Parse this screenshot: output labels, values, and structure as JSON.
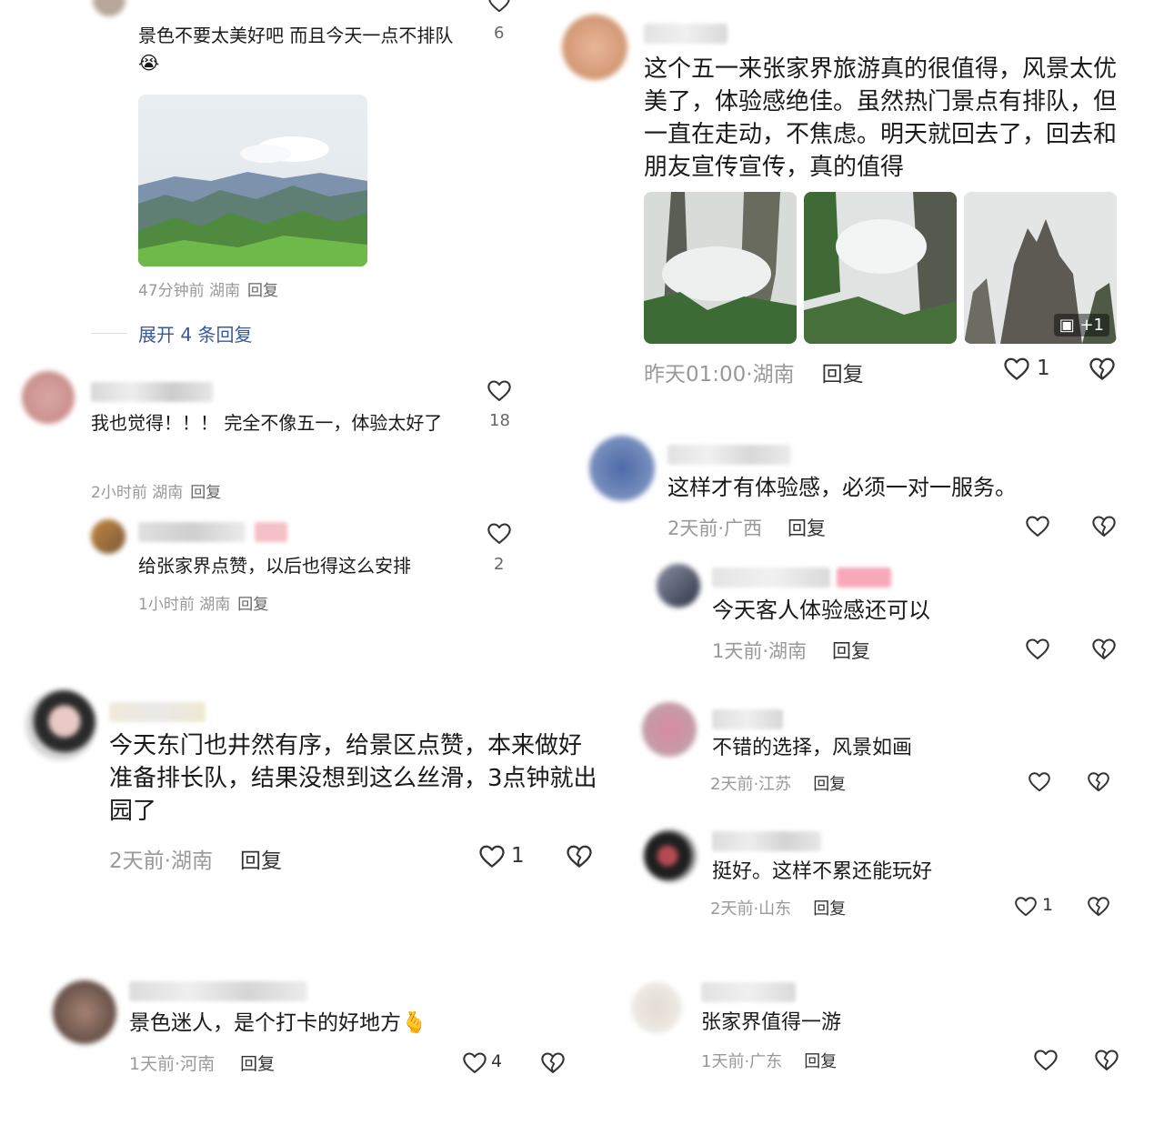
{
  "c1": {
    "text": "景色不要太美好吧 而且今天一点不排队",
    "emoji": "😭",
    "meta": "47分钟前 湖南",
    "reply": "回复",
    "likes": "6"
  },
  "expand": {
    "label": "展开 4 条回复"
  },
  "c2": {
    "text": "我也觉得！！！ 完全不像五一，体验太好了",
    "meta": "2小时前 湖南",
    "reply": "回复",
    "likes": "18"
  },
  "c2r": {
    "text": "给张家界点赞，以后也得这么安排",
    "meta": "1小时前 湖南",
    "reply": "回复",
    "likes": "2"
  },
  "c3": {
    "text": "今天东门也井然有序，给景区点赞，本来做好准备排长队，结果没想到这么丝滑，3点钟就出园了",
    "meta": "2天前·湖南",
    "reply": "回复",
    "likes": "1"
  },
  "c4": {
    "text": "景色迷人，是个打卡的好地方",
    "emoji": "🫰",
    "meta": "1天前·河南",
    "reply": "回复",
    "likes": "4"
  },
  "r1": {
    "text": "这个五一来张家界旅游真的很值得，风景太优美了，体验感绝佳。虽然热门景点有排队，但一直在走动，不焦虑。明天就回去了，回去和朋友宣传宣传，真的值得",
    "meta": "昨天01:00·湖南",
    "reply": "回复",
    "likes": "1",
    "more_photos": "+1"
  },
  "r2": {
    "text": "这样才有体验感，必须一对一服务。",
    "meta": "2天前·广西",
    "reply": "回复"
  },
  "r2r": {
    "text": "今天客人体验感还可以",
    "meta": "1天前·湖南",
    "reply": "回复"
  },
  "r3": {
    "text": "不错的选择，风景如画",
    "meta": "2天前·江苏",
    "reply": "回复"
  },
  "r4": {
    "text": "挺好。这样不累还能玩好",
    "meta": "2天前·山东",
    "reply": "回复",
    "likes": "1"
  },
  "r5": {
    "text": "张家界值得一游",
    "meta": "1天前·广东",
    "reply": "回复"
  },
  "colors": {
    "text": "#1a1a1a",
    "meta": "#999999",
    "link": "#3b5998"
  }
}
